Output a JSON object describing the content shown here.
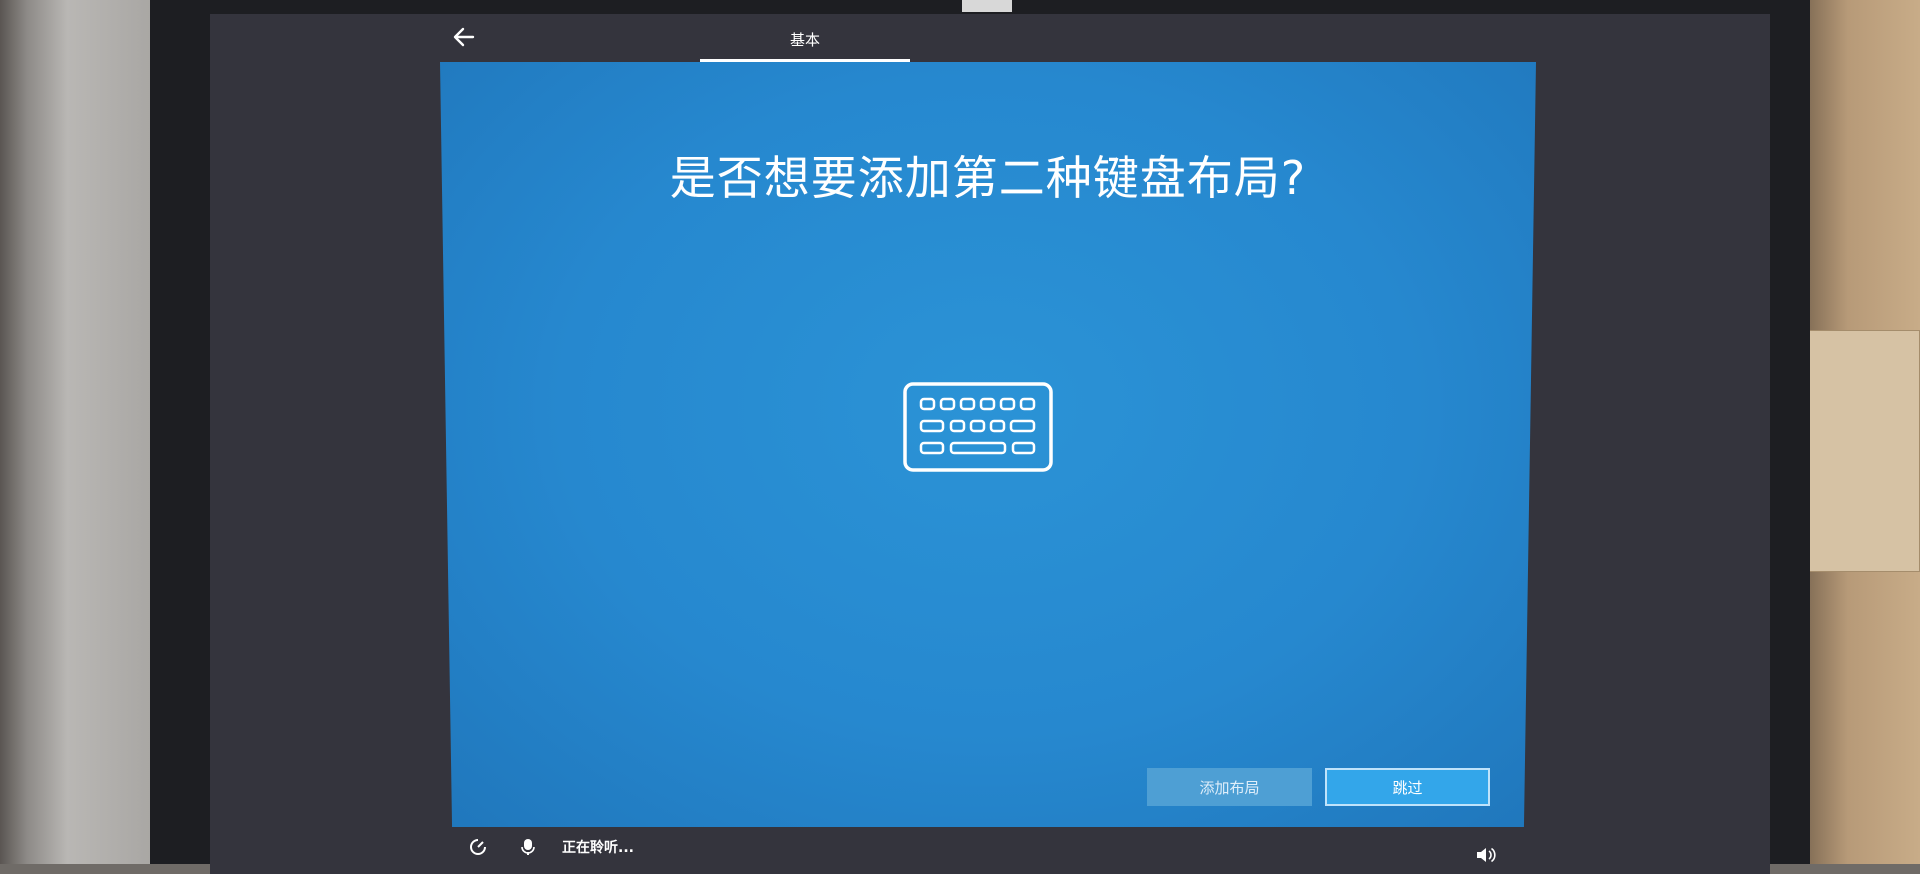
{
  "header": {
    "back_icon": "arrow-left-icon",
    "tab_label": "基本"
  },
  "panel": {
    "title": "是否想要添加第二种键盘布局?",
    "illustration_icon": "keyboard-icon",
    "background_color": "#2688cf"
  },
  "buttons": {
    "add_layout_label": "添加布局",
    "skip_label": "跳过"
  },
  "status_bar": {
    "ease_of_access_icon": "ease-of-access-icon",
    "microphone_icon": "microphone-icon",
    "listening_text": "正在聆听...",
    "volume_icon": "volume-icon"
  }
}
